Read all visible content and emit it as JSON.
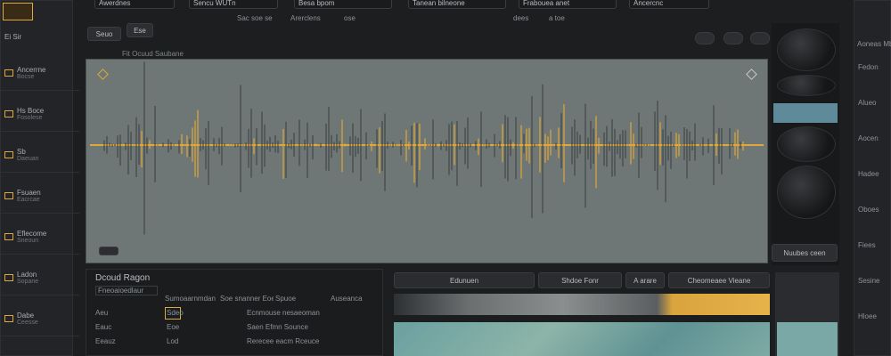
{
  "left_sidebar": {
    "top_label": "Ei Sir",
    "items": [
      {
        "label": "Ancerrne",
        "sub": "Bocse"
      },
      {
        "label": "Hs Boce",
        "sub": "Fosolese"
      },
      {
        "label": "Sb",
        "sub": "Daeuan"
      },
      {
        "label": "Fsuaen",
        "sub": "Eacrcae"
      },
      {
        "label": "Eflecome",
        "sub": "Sneoun"
      },
      {
        "label": "Ladon",
        "sub": "Sopane"
      },
      {
        "label": "Dabe",
        "sub": "Ceesse"
      }
    ]
  },
  "top_bar": {
    "fields": [
      "Awerdnes",
      "Sencu WUTn",
      "Besa bpom",
      "Tanean bilneone",
      "Frabouea anet",
      "Ancercnc"
    ],
    "toolbar_items": [
      "Sac soe se",
      "Arerclens",
      "ose",
      "dees",
      "a toe"
    ],
    "left_buttons": [
      "Seuo",
      "Ese"
    ]
  },
  "waveform": {
    "title": "Fit Ocuud Saubane",
    "waveform_color": "#e0a83a",
    "bar_color": "#3a3d3f",
    "plot_bg": "#6e7775"
  },
  "bottom_left": {
    "title": "Dcoud Ragon",
    "label": "Fneoaioedlaur",
    "columns": [
      "Sumoaarnmdan",
      "Soe snanner Eoe",
      "Spuoe",
      "Auseanca"
    ],
    "rows": [
      {
        "a": "Aeu",
        "b": "Sdeo",
        "c": "Ecnmouse nesaeoman"
      },
      {
        "a": "Eauc",
        "b": "Eoe",
        "c": "Saen Efmn Sounce"
      },
      {
        "a": "Eeauz",
        "b": "Lod",
        "c": "Rerecee eacm Rceuce"
      }
    ]
  },
  "bottom_right": {
    "tabs": [
      "Edunuen",
      "Shdoe Fonr",
      "A arare",
      "Cheomeaee Vieane"
    ],
    "side_label": "Nuubes ceen"
  },
  "right_column": {
    "label": "Aoneas Mb",
    "items": [
      "Fedon",
      "Alueo",
      "Aocen",
      "Hadee",
      "Oboes",
      "Fiees",
      "Sesine",
      "Hloee"
    ]
  }
}
